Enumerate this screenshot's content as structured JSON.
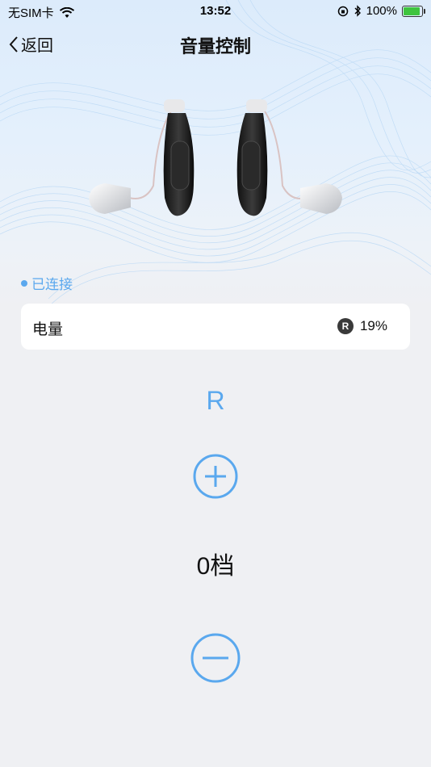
{
  "status_bar": {
    "carrier": "无SIM卡",
    "time": "13:52",
    "battery_percent": "100%",
    "icons": [
      "wifi-icon",
      "orientation-lock-icon",
      "bluetooth-icon",
      "battery-charging-icon"
    ]
  },
  "nav": {
    "back_label": "返回",
    "title": "音量控制"
  },
  "device": {
    "image": "hearing-aids-pair",
    "status": "已连接"
  },
  "battery_card": {
    "label": "电量",
    "badge": "R",
    "value": "19%"
  },
  "volume": {
    "side": "R",
    "level_text": "0档",
    "increase_icon": "plus-circle-icon",
    "decrease_icon": "minus-circle-icon"
  },
  "colors": {
    "accent": "#5aa8ee",
    "background": "#eff0f3",
    "card": "#ffffff"
  }
}
